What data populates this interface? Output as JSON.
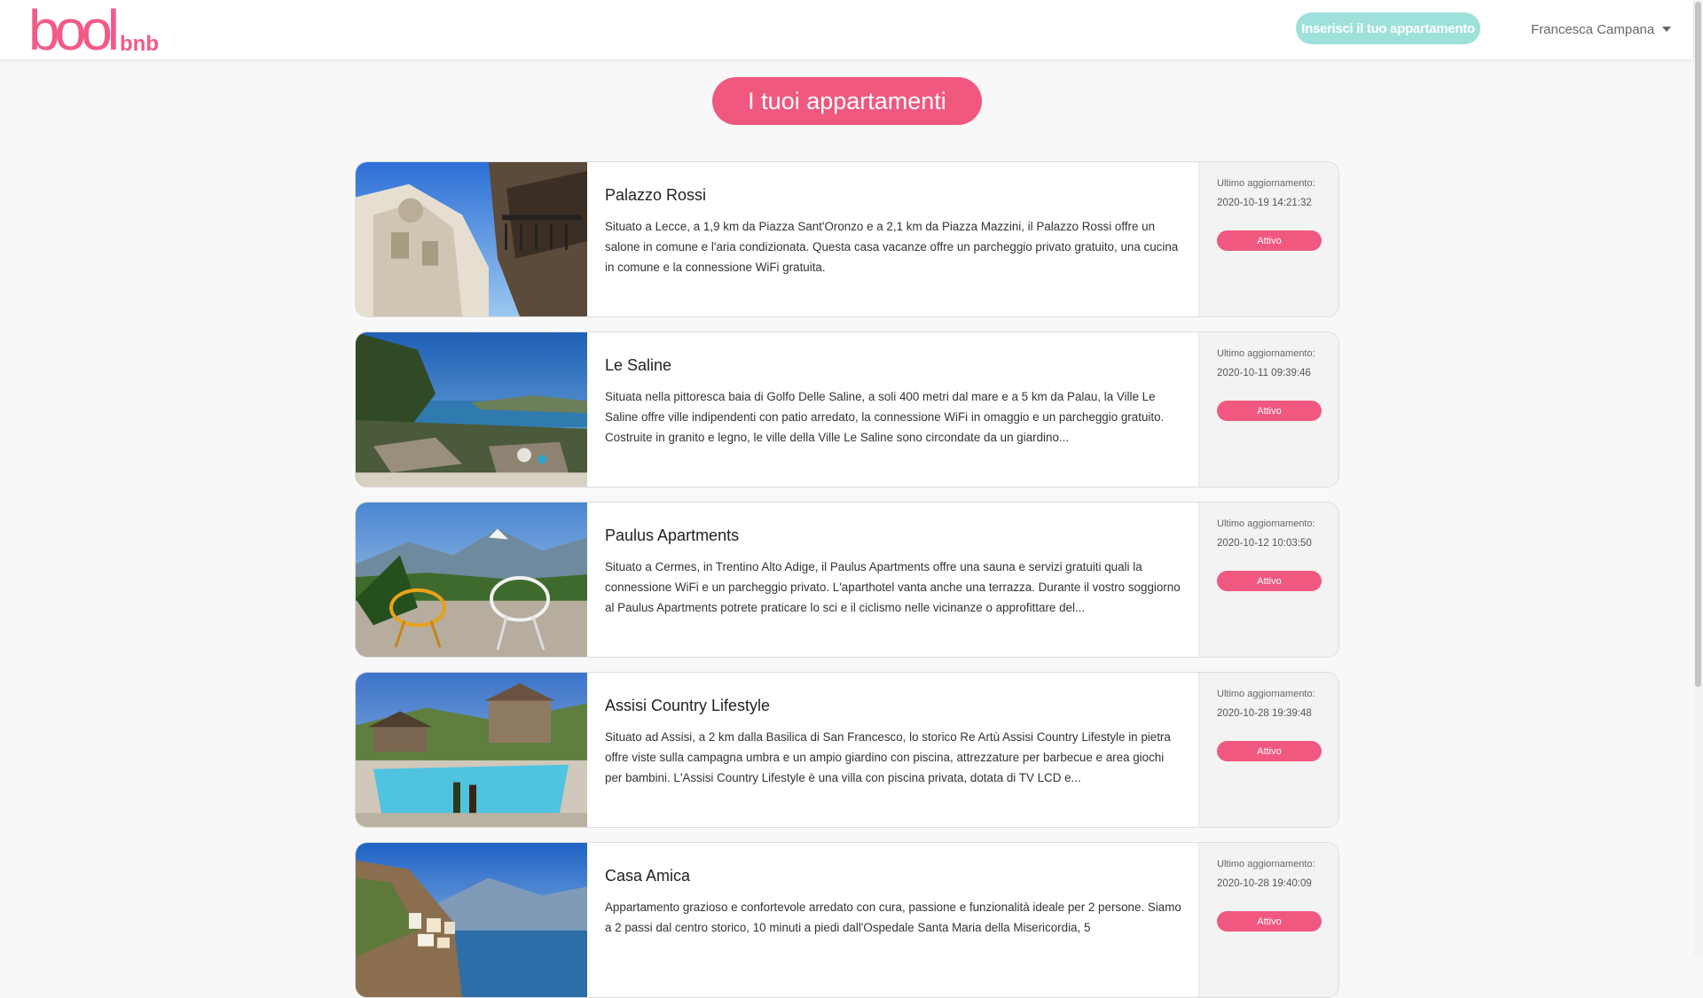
{
  "brand": {
    "logo_mark": "bool",
    "logo_sub": "bnb",
    "primary_color": "#f0587f",
    "accent_color": "#9ee0da"
  },
  "header": {
    "cta_label": "Inserisci il tuo appartamento",
    "user_name": "Francesca Campana"
  },
  "page": {
    "title": "I tuoi appartamenti"
  },
  "apartments": [
    {
      "title": "Palazzo Rossi",
      "description": "Situato a Lecce, a 1,9 km da Piazza Sant'Oronzo e a 2,1 km da Piazza Mazzini, il Palazzo Rossi offre un salone in comune e l'aria condizionata. Questa casa vacanze offre un parcheggio privato gratuito, una cucina in comune e la connessione WiFi gratuita.",
      "updated_label": "Ultimo aggiornamento:",
      "updated_at": "2020-10-19 14:21:32",
      "status": "Attivo",
      "image": "baroque-palace-photo"
    },
    {
      "title": "Le Saline",
      "description": "Situata nella pittoresca baia di Golfo Delle Saline, a soli 400 metri dal mare e a 5 km da Palau, la Ville Le Saline offre ville indipendenti con patio arredato, la connessione WiFi in omaggio e un parcheggio gratuito. Costruite in granito e legno, le ville della Ville Le Saline sono circondate da un giardino...",
      "updated_label": "Ultimo aggiornamento:",
      "updated_at": "2020-10-11 09:39:46",
      "status": "Attivo",
      "image": "sea-terrace-photo"
    },
    {
      "title": "Paulus Apartments",
      "description": "Situato a Cermes, in Trentino Alto Adige, il Paulus Apartments offre una sauna e servizi gratuiti quali la connessione WiFi e un parcheggio privato. L'aparthotel vanta anche una terrazza. Durante il vostro soggiorno al Paulus Apartments potrete praticare lo sci e il ciclismo nelle vicinanze o approfittare del...",
      "updated_label": "Ultimo aggiornamento:",
      "updated_at": "2020-10-12 10:03:50",
      "status": "Attivo",
      "image": "mountain-chairs-photo"
    },
    {
      "title": "Assisi Country Lifestyle",
      "description": "Situato ad Assisi, a 2 km dalla Basilica di San Francesco, lo storico Re Artù Assisi Country Lifestyle in pietra offre viste sulla campagna umbra e un ampio giardino con piscina, attrezzature per barbecue e area giochi per bambini. L'Assisi Country Lifestyle è una villa con piscina privata, dotata di TV LCD e...",
      "updated_label": "Ultimo aggiornamento:",
      "updated_at": "2020-10-28 19:39:48",
      "status": "Attivo",
      "image": "villa-pool-photo"
    },
    {
      "title": "Casa Amica",
      "description": "Appartamento grazioso e confortevole arredato con cura, passione e funzionalità ideale per 2 persone. Siamo a 2 passi dal centro storico, 10 minuti a piedi dall'Ospedale Santa Maria della Misericordia, 5",
      "updated_label": "Ultimo aggiornamento:",
      "updated_at": "2020-10-28 19:40:09",
      "status": "Attivo",
      "image": "coastal-town-photo"
    }
  ]
}
